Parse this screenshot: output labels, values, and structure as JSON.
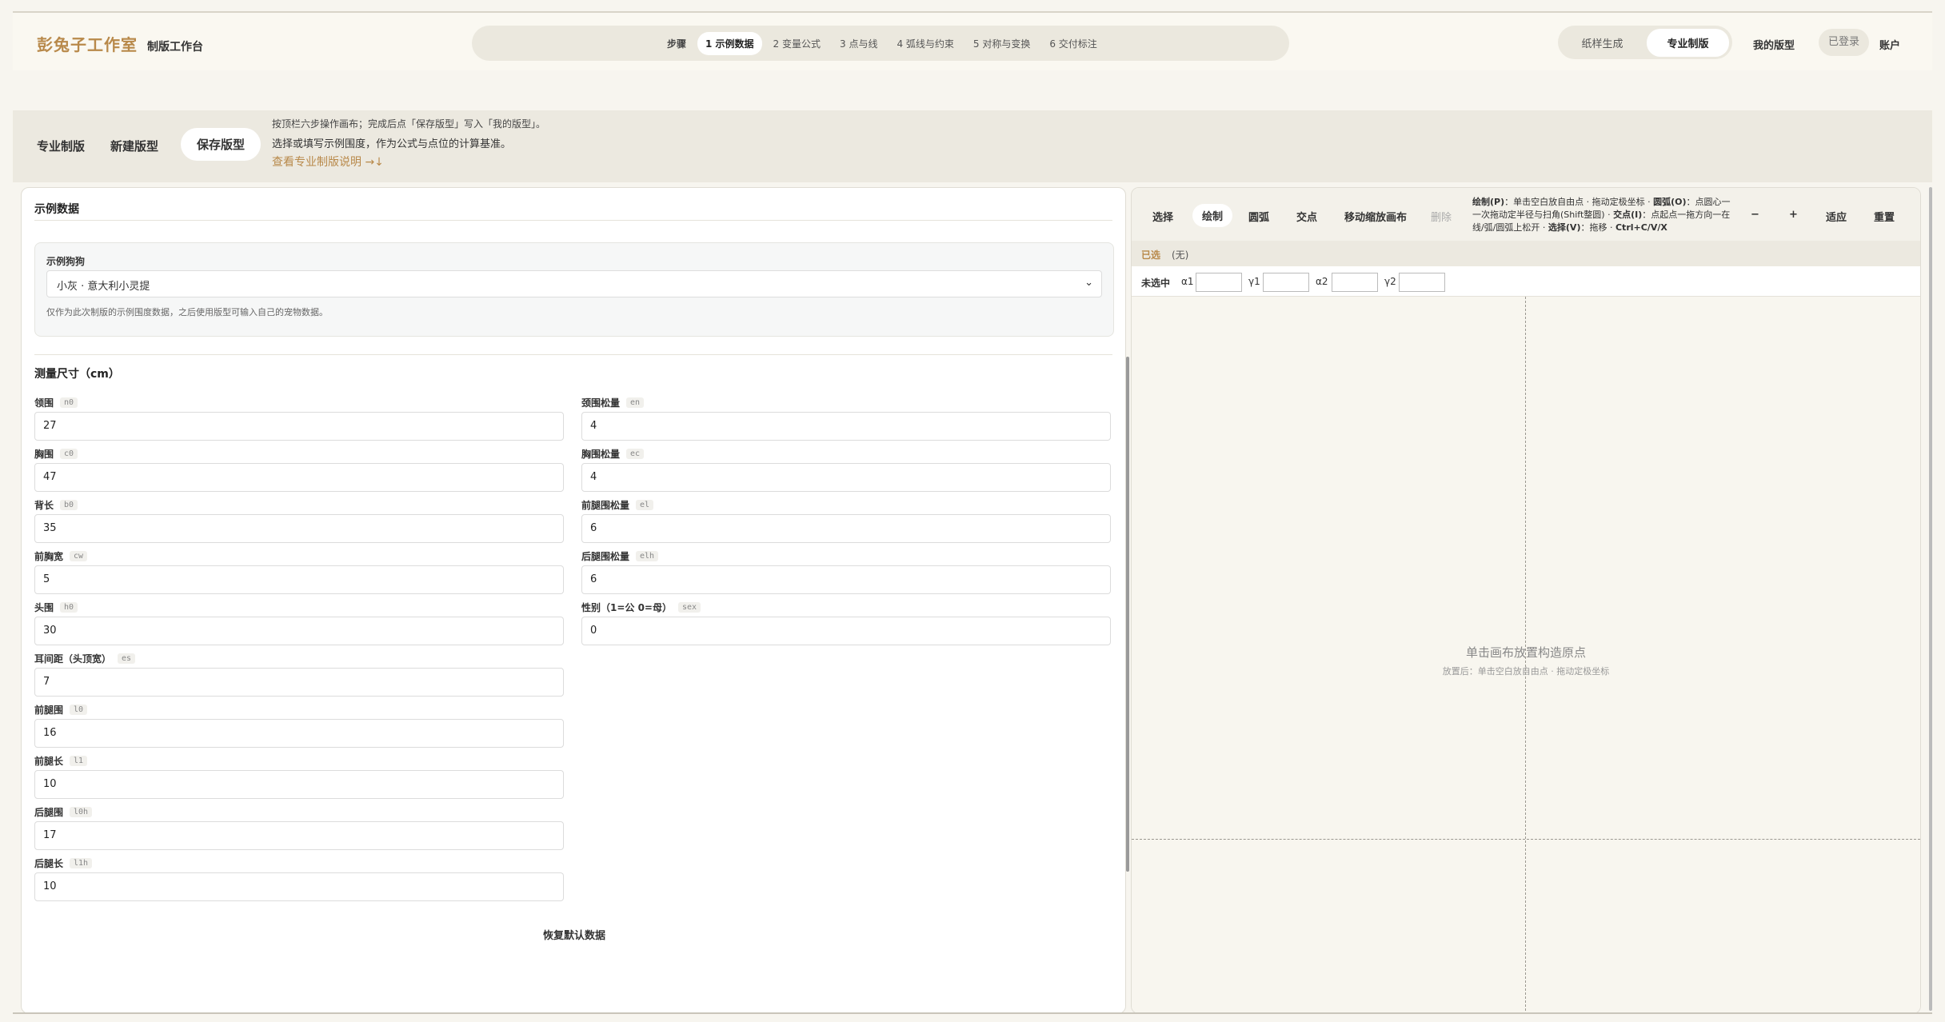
{
  "brand": {
    "name": "彭兔子工作室",
    "subtitle": "制版工作台"
  },
  "steps": {
    "label": "步骤",
    "items": [
      "1 示例数据",
      "2 变量公式",
      "3 点与线",
      "4 弧线与约束",
      "5 对称与变换",
      "6 交付标注"
    ],
    "active_index": 0
  },
  "mode": {
    "items": [
      "纸样生成",
      "专业制版"
    ],
    "active": "专业制版"
  },
  "nav": {
    "my_patterns": "我的版型",
    "login_status": "已登录",
    "account": "账户"
  },
  "subbar": {
    "tabs": [
      "专业制版",
      "新建版型",
      "保存版型"
    ],
    "active_tab": "保存版型",
    "hint_line1": "按顶栏六步操作画布；完成后点「保存版型」写入「我的版型」。",
    "hint_line2": "选择或填写示例围度，作为公式与点位的计算基准。",
    "help_link": "查看专业制版说明 →↓"
  },
  "sample": {
    "section_title": "示例数据",
    "dog_label": "示例狗狗",
    "dog_value": "小灰 · 意大利小灵提",
    "note": "仅作为此次制版的示例围度数据，之后使用版型可输入自己的宠物数据。"
  },
  "measure": {
    "section_title": "测量尺寸（cm）",
    "left_fields": [
      {
        "label": "领围",
        "code": "n0",
        "value": "27"
      },
      {
        "label": "胸围",
        "code": "c0",
        "value": "47"
      },
      {
        "label": "背长",
        "code": "b0",
        "value": "35"
      },
      {
        "label": "前胸宽",
        "code": "cw",
        "value": "5"
      },
      {
        "label": "头围",
        "code": "h0",
        "value": "30"
      },
      {
        "label": "耳间距（头顶宽）",
        "code": "es",
        "value": "7"
      },
      {
        "label": "前腿围",
        "code": "l0",
        "value": "16"
      },
      {
        "label": "前腿长",
        "code": "l1",
        "value": "10"
      },
      {
        "label": "后腿围",
        "code": "l0h",
        "value": "17"
      },
      {
        "label": "后腿长",
        "code": "l1h",
        "value": "10"
      }
    ],
    "right_fields": [
      {
        "label": "颈围松量",
        "code": "en",
        "value": "4"
      },
      {
        "label": "胸围松量",
        "code": "ec",
        "value": "4"
      },
      {
        "label": "前腿围松量",
        "code": "el",
        "value": "6"
      },
      {
        "label": "后腿围松量",
        "code": "elh",
        "value": "6"
      },
      {
        "label": "性别（1=公 0=母）",
        "code": "sex",
        "value": "0"
      }
    ],
    "restore_label": "恢复默认数据"
  },
  "tools": {
    "items": [
      "选择",
      "绘制",
      "圆弧",
      "交点",
      "移动缩放画布",
      "删除"
    ],
    "active": "绘制",
    "disabled": "删除",
    "zoom_out": "−",
    "zoom_in": "+",
    "fit": "适应",
    "reset": "重置",
    "help": {
      "draw_key": "绘制(P)",
      "draw_text": "：单击空白放自由点 · 拖动定极坐标 · ",
      "arc_key": "圆弧(O)",
      "arc_text": "：点圆心一一次拖动定半径与扫角(Shift整圆) · ",
      "isect_key": "交点(I)",
      "isect_text": "：点起点一拖方向一在线/弧/圆弧上松开 · ",
      "select_key": "选择(V)",
      "select_text": "：拖移 · ",
      "shortcut": "Ctrl+C/V/X"
    }
  },
  "selection": {
    "label": "已选",
    "value": "(无)"
  },
  "coords": {
    "status": "未选中",
    "labels": [
      "α1",
      "γ1",
      "α2",
      "γ2"
    ]
  },
  "canvas": {
    "message": "单击画布放置构造原点",
    "sub_message": "放置后：单击空白放自由点 · 拖动定极坐标"
  }
}
